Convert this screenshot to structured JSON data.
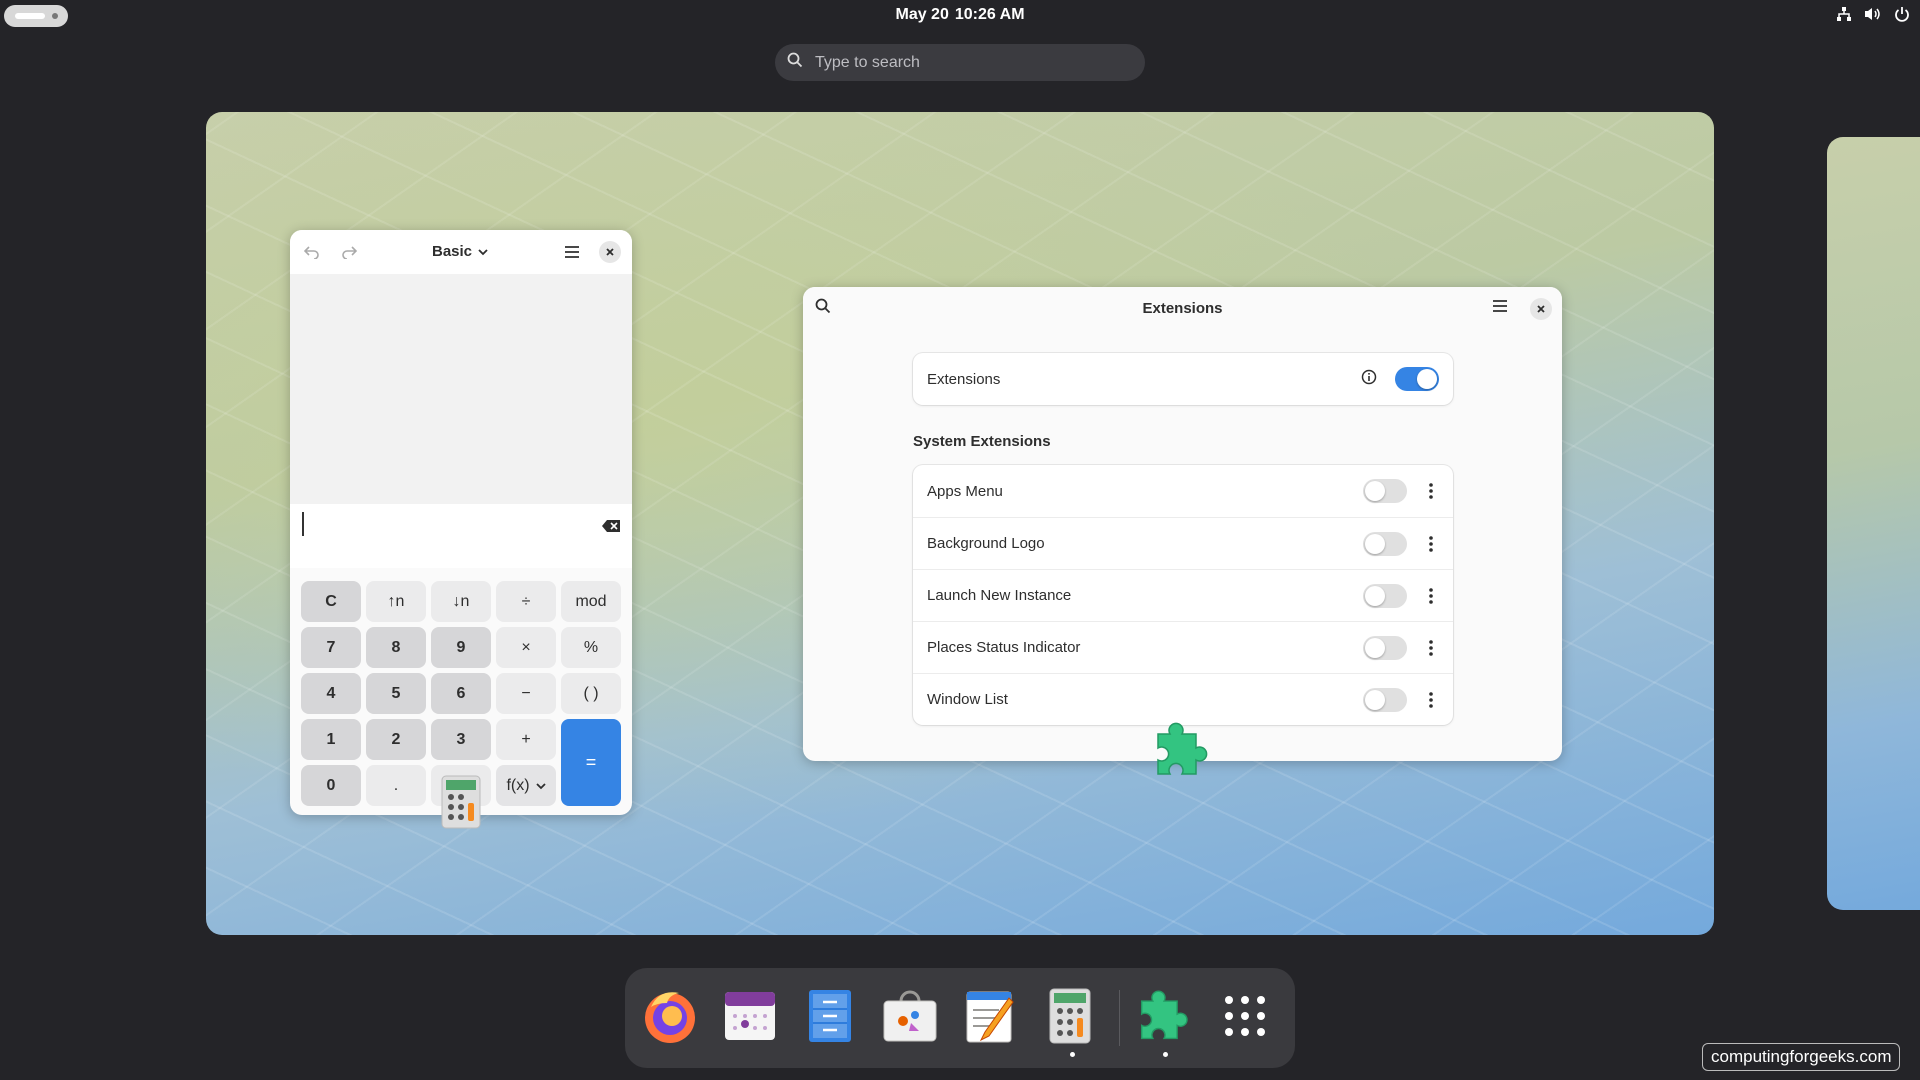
{
  "topbar": {
    "date": "May 20",
    "time": "10:26 AM",
    "tray_icons": [
      "network-icon",
      "volume-icon",
      "power-icon"
    ]
  },
  "search": {
    "placeholder": "Type to search"
  },
  "calculator": {
    "mode": "Basic",
    "keys": [
      {
        "label": "C",
        "kind": "num"
      },
      {
        "label": "↑n",
        "kind": "op"
      },
      {
        "label": "↓n",
        "kind": "op"
      },
      {
        "label": "÷",
        "kind": "op"
      },
      {
        "label": "mod",
        "kind": "op"
      },
      {
        "label": "7",
        "kind": "num"
      },
      {
        "label": "8",
        "kind": "num"
      },
      {
        "label": "9",
        "kind": "num"
      },
      {
        "label": "×",
        "kind": "op"
      },
      {
        "label": "%",
        "kind": "op"
      },
      {
        "label": "4",
        "kind": "num"
      },
      {
        "label": "5",
        "kind": "num"
      },
      {
        "label": "6",
        "kind": "num"
      },
      {
        "label": "−",
        "kind": "op"
      },
      {
        "label": "( )",
        "kind": "op"
      },
      {
        "label": "1",
        "kind": "num"
      },
      {
        "label": "2",
        "kind": "num"
      },
      {
        "label": "3",
        "kind": "num"
      },
      {
        "label": "+",
        "kind": "op"
      },
      {
        "label": "=",
        "kind": "eq"
      },
      {
        "label": "0",
        "kind": "num"
      },
      {
        "label": ".",
        "kind": "op"
      },
      {
        "label": "",
        "kind": "op"
      },
      {
        "label": "f(x)",
        "kind": "fx"
      }
    ]
  },
  "extensions": {
    "title": "Extensions",
    "main_row": {
      "label": "Extensions",
      "enabled": true
    },
    "section_title": "System Extensions",
    "items": [
      {
        "label": "Apps Menu",
        "enabled": false
      },
      {
        "label": "Background Logo",
        "enabled": false
      },
      {
        "label": "Launch New Instance",
        "enabled": false
      },
      {
        "label": "Places Status Indicator",
        "enabled": false
      },
      {
        "label": "Window List",
        "enabled": false
      }
    ]
  },
  "dock": {
    "apps": [
      "firefox-icon",
      "calendar-icon",
      "files-icon",
      "software-icon",
      "text-editor-icon",
      "calculator-icon",
      "extensions-icon",
      "app-grid-icon"
    ]
  },
  "watermark": "computingforgeeks.com",
  "colors": {
    "accent": "#3584e4",
    "extension_green": "#33c481"
  }
}
